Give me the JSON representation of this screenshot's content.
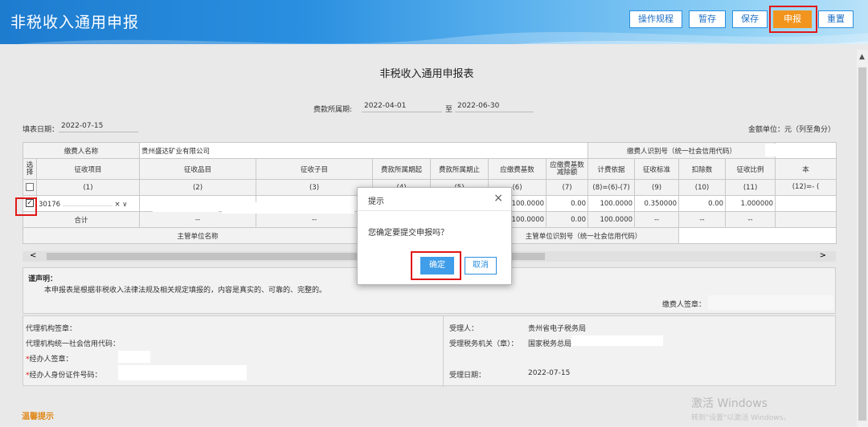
{
  "app": {
    "title": "非税收入通用申报"
  },
  "toolbar": {
    "procedure_label": "操作规程",
    "draft_label": "暂存",
    "save_label": "保存",
    "submit_label": "申报",
    "reset_label": "重置"
  },
  "form": {
    "title": "非税收入通用申报表",
    "period_label": "费款所属期:",
    "period_start": "2022-04-01",
    "period_to": "至",
    "period_end": "2022-06-30",
    "fill_date_label": "填表日期：",
    "fill_date": "2022-07-15",
    "unit_label": "金额单位：元（列至角分）",
    "payer_name_label": "缴费人名称",
    "payer_name": "贵州盛达矿业有限公司",
    "payer_id_label": "缴费人识别号（统一社会信用代码）"
  },
  "table": {
    "headers": [
      "选择",
      "征收项目",
      "征收品目",
      "征收子目",
      "费款所属期起",
      "费款所属期止",
      "应缴费基数",
      "应缴费基数减除额",
      "计费依据",
      "征收标准",
      "扣除数",
      "征收比例",
      "本"
    ],
    "index_row": [
      "(1)",
      "(2)",
      "(3)",
      "(4)",
      "(5)",
      "(6)",
      "(7)",
      "(8)=(6)-(7)",
      "(9)",
      "(10)",
      "(11)",
      "(12)=- ("
    ],
    "row": {
      "code": "30176",
      "clear": "×",
      "caret": "∨",
      "base": "100.0000",
      "deduct_base": "0.00",
      "basis": "100.0000",
      "standard": "0.350000",
      "deduction": "0.00",
      "ratio": "1.000000"
    },
    "total": {
      "label": "合计",
      "dash": "--",
      "base": "100.0000",
      "deduct_base": "0.00",
      "basis": "100.0000"
    },
    "supervisor_name_label": "主管单位名称",
    "supervisor_id_label": "主管单位识别号（统一社会信用代码）"
  },
  "declaration": {
    "title": "谨声明：",
    "text": "本申报表是根据非税收入法律法规及相关规定填报的，内容是真实的、可靠的、完整的。",
    "payer_sign_label": "缴费人签章："
  },
  "agent": {
    "agency_sign_label": "代理机构签章：",
    "agency_credit_label": "代理机构统一社会信用代码：",
    "handler_sign_label": "经办人签章：",
    "handler_id_label": "经办人身份证件号码：",
    "required_mark": "*"
  },
  "receiver": {
    "receiver_label": "受理人：",
    "receiver_value": "贵州省电子税务局",
    "office_label": "受理税务机关（章）：",
    "office_value": "国家税务总局",
    "date_label": "受理日期：",
    "date_value": "2022-07-15"
  },
  "tips": {
    "label": "温馨提示"
  },
  "dialog": {
    "title": "提示",
    "close": "×",
    "message": "您确定要提交申报吗？",
    "ok_label": "确定",
    "cancel_label": "取消"
  },
  "scroll": {
    "left": "<",
    "right": ">",
    "up": "▲"
  },
  "watermark": {
    "line1": "激活 Windows",
    "line2": "转到\"设置\"以激活 Windows。"
  },
  "colors": {
    "header": "#2a8fe0",
    "accent": "#f2951f",
    "highlight": "#e01818",
    "confirm": "#3f9de9"
  }
}
